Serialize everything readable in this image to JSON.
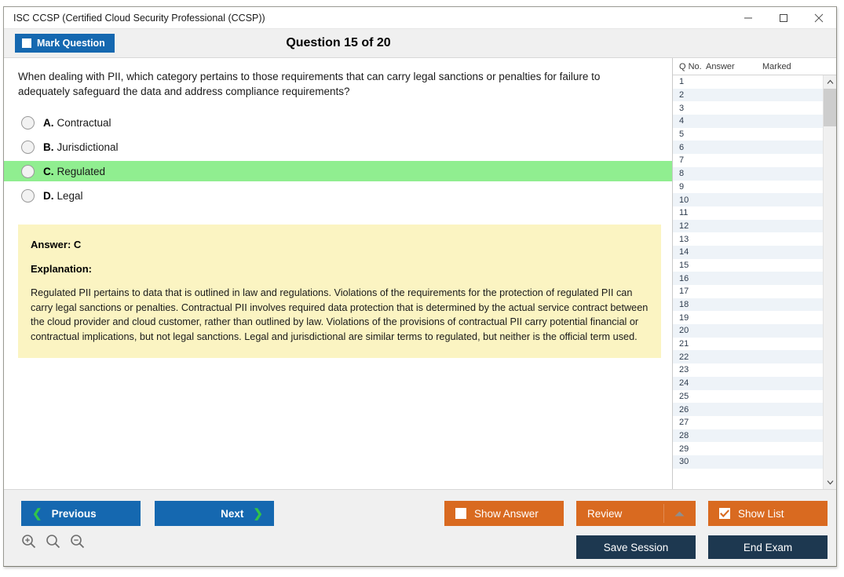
{
  "window": {
    "title": "ISC CCSP (Certified Cloud Security Professional (CCSP))",
    "minimize_label": "—",
    "maximize_label": "☐",
    "close_label": "×"
  },
  "header": {
    "mark_question_label": "Mark Question",
    "mark_question_checked": false,
    "question_counter": "Question 15 of 20"
  },
  "question": {
    "text": "When dealing with PII, which category pertains to those requirements that can carry legal sanctions or penalties for failure to adequately safeguard the data and address compliance requirements?",
    "options": [
      {
        "letter": "A.",
        "text": "Contractual",
        "selected": false,
        "highlight": false
      },
      {
        "letter": "B.",
        "text": "Jurisdictional",
        "selected": false,
        "highlight": false
      },
      {
        "letter": "C.",
        "text": "Regulated",
        "selected": false,
        "highlight": true
      },
      {
        "letter": "D.",
        "text": "Legal",
        "selected": false,
        "highlight": false
      }
    ]
  },
  "explanation": {
    "answer_label": "Answer: C",
    "explanation_label": "Explanation:",
    "body": "Regulated PII pertains to data that is outlined in law and regulations. Violations of the requirements for the protection of regulated PII can carry legal sanctions or penalties. Contractual PII involves required data protection that is determined by the actual service contract between the cloud provider and cloud customer, rather than outlined by law. Violations of the provisions of contractual PII carry potential financial or contractual implications, but not legal sanctions. Legal and jurisdictional are similar terms to regulated, but neither is the official term used."
  },
  "question_list": {
    "columns": [
      "Q No.",
      "Answer",
      "Marked"
    ],
    "rows": [
      {
        "qno": "1",
        "answer": "",
        "marked": ""
      },
      {
        "qno": "2",
        "answer": "",
        "marked": ""
      },
      {
        "qno": "3",
        "answer": "",
        "marked": ""
      },
      {
        "qno": "4",
        "answer": "",
        "marked": ""
      },
      {
        "qno": "5",
        "answer": "",
        "marked": ""
      },
      {
        "qno": "6",
        "answer": "",
        "marked": ""
      },
      {
        "qno": "7",
        "answer": "",
        "marked": ""
      },
      {
        "qno": "8",
        "answer": "",
        "marked": ""
      },
      {
        "qno": "9",
        "answer": "",
        "marked": ""
      },
      {
        "qno": "10",
        "answer": "",
        "marked": ""
      },
      {
        "qno": "11",
        "answer": "",
        "marked": ""
      },
      {
        "qno": "12",
        "answer": "",
        "marked": ""
      },
      {
        "qno": "13",
        "answer": "",
        "marked": ""
      },
      {
        "qno": "14",
        "answer": "",
        "marked": ""
      },
      {
        "qno": "15",
        "answer": "",
        "marked": ""
      },
      {
        "qno": "16",
        "answer": "",
        "marked": ""
      },
      {
        "qno": "17",
        "answer": "",
        "marked": ""
      },
      {
        "qno": "18",
        "answer": "",
        "marked": ""
      },
      {
        "qno": "19",
        "answer": "",
        "marked": ""
      },
      {
        "qno": "20",
        "answer": "",
        "marked": ""
      },
      {
        "qno": "21",
        "answer": "",
        "marked": ""
      },
      {
        "qno": "22",
        "answer": "",
        "marked": ""
      },
      {
        "qno": "23",
        "answer": "",
        "marked": ""
      },
      {
        "qno": "24",
        "answer": "",
        "marked": ""
      },
      {
        "qno": "25",
        "answer": "",
        "marked": ""
      },
      {
        "qno": "26",
        "answer": "",
        "marked": ""
      },
      {
        "qno": "27",
        "answer": "",
        "marked": ""
      },
      {
        "qno": "28",
        "answer": "",
        "marked": ""
      },
      {
        "qno": "29",
        "answer": "",
        "marked": ""
      },
      {
        "qno": "30",
        "answer": "",
        "marked": ""
      }
    ]
  },
  "footer": {
    "previous_label": "Previous",
    "next_label": "Next",
    "show_answer_label": "Show Answer",
    "show_answer_checked": false,
    "review_label": "Review",
    "show_list_label": "Show List",
    "show_list_checked": true,
    "save_session_label": "Save Session",
    "end_exam_label": "End Exam"
  },
  "colors": {
    "blue": "#1568b0",
    "orange": "#d96a20",
    "navy": "#1d3850",
    "correct_green": "#90ee90",
    "chevron_green": "#31c44a",
    "explanation_yellow": "#fbf4c2"
  }
}
